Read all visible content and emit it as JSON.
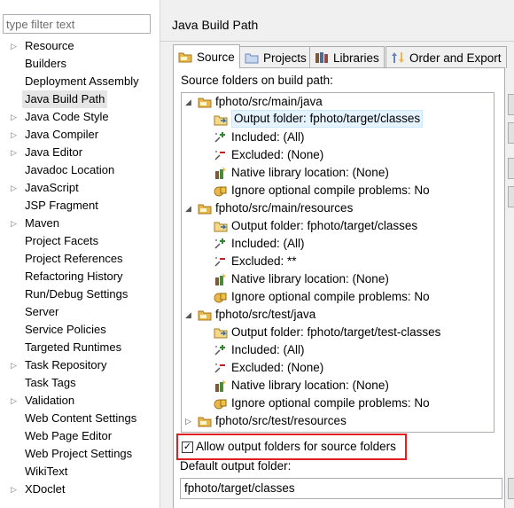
{
  "filter": {
    "placeholder": "type filter text"
  },
  "nav": {
    "items": [
      {
        "label": "Resource",
        "expandable": true
      },
      {
        "label": "Builders",
        "expandable": false
      },
      {
        "label": "Deployment Assembly",
        "expandable": false
      },
      {
        "label": "Java Build Path",
        "expandable": false,
        "selected": true
      },
      {
        "label": "Java Code Style",
        "expandable": true
      },
      {
        "label": "Java Compiler",
        "expandable": true
      },
      {
        "label": "Java Editor",
        "expandable": true
      },
      {
        "label": "Javadoc Location",
        "expandable": false
      },
      {
        "label": "JavaScript",
        "expandable": true
      },
      {
        "label": "JSP Fragment",
        "expandable": false
      },
      {
        "label": "Maven",
        "expandable": true
      },
      {
        "label": "Project Facets",
        "expandable": false
      },
      {
        "label": "Project References",
        "expandable": false
      },
      {
        "label": "Refactoring History",
        "expandable": false
      },
      {
        "label": "Run/Debug Settings",
        "expandable": false
      },
      {
        "label": "Server",
        "expandable": false
      },
      {
        "label": "Service Policies",
        "expandable": false
      },
      {
        "label": "Targeted Runtimes",
        "expandable": false
      },
      {
        "label": "Task Repository",
        "expandable": true
      },
      {
        "label": "Task Tags",
        "expandable": false
      },
      {
        "label": "Validation",
        "expandable": true
      },
      {
        "label": "Web Content Settings",
        "expandable": false
      },
      {
        "label": "Web Page Editor",
        "expandable": false
      },
      {
        "label": "Web Project Settings",
        "expandable": false
      },
      {
        "label": "WikiText",
        "expandable": false
      },
      {
        "label": "XDoclet",
        "expandable": true
      }
    ]
  },
  "page": {
    "title": "Java Build Path"
  },
  "tabs": [
    {
      "label": "Source",
      "icon": "source-folder-icon",
      "active": true
    },
    {
      "label": "Projects",
      "icon": "projects-icon",
      "active": false
    },
    {
      "label": "Libraries",
      "icon": "libraries-icon",
      "active": false
    },
    {
      "label": "Order and Export",
      "icon": "order-export-icon",
      "active": false
    }
  ],
  "source": {
    "heading": "Source folders on build path:",
    "tree": [
      {
        "type": "folder",
        "label": "fphoto/src/main/java",
        "expanded": true
      },
      {
        "type": "output",
        "label": "Output folder: fphoto/target/classes",
        "selected": true
      },
      {
        "type": "included",
        "label": "Included: (All)"
      },
      {
        "type": "excluded",
        "label": "Excluded: (None)"
      },
      {
        "type": "native",
        "label": "Native library location: (None)"
      },
      {
        "type": "ignore",
        "label": "Ignore optional compile problems: No"
      },
      {
        "type": "folder",
        "label": "fphoto/src/main/resources",
        "expanded": true
      },
      {
        "type": "output",
        "label": "Output folder: fphoto/target/classes"
      },
      {
        "type": "included",
        "label": "Included: (All)"
      },
      {
        "type": "excluded",
        "label": "Excluded: **"
      },
      {
        "type": "native",
        "label": "Native library location: (None)"
      },
      {
        "type": "ignore",
        "label": "Ignore optional compile problems: No"
      },
      {
        "type": "folder",
        "label": "fphoto/src/test/java",
        "expanded": true
      },
      {
        "type": "output",
        "label": "Output folder: fphoto/target/test-classes"
      },
      {
        "type": "included",
        "label": "Included: (All)"
      },
      {
        "type": "excluded",
        "label": "Excluded: (None)"
      },
      {
        "type": "native",
        "label": "Native library location: (None)"
      },
      {
        "type": "ignore",
        "label": "Ignore optional compile problems: No"
      },
      {
        "type": "folder",
        "label": "fphoto/src/test/resources",
        "expanded": false
      }
    ],
    "allow_output_label": "Allow output folders for source folders",
    "allow_output_checked": true,
    "default_output_label": "Default output folder:",
    "default_output_value": "fphoto/target/classes"
  },
  "colors": {
    "highlight_box": "#e02020",
    "selection_bg": "#e5f3ff",
    "folder": "#e8b84a"
  }
}
